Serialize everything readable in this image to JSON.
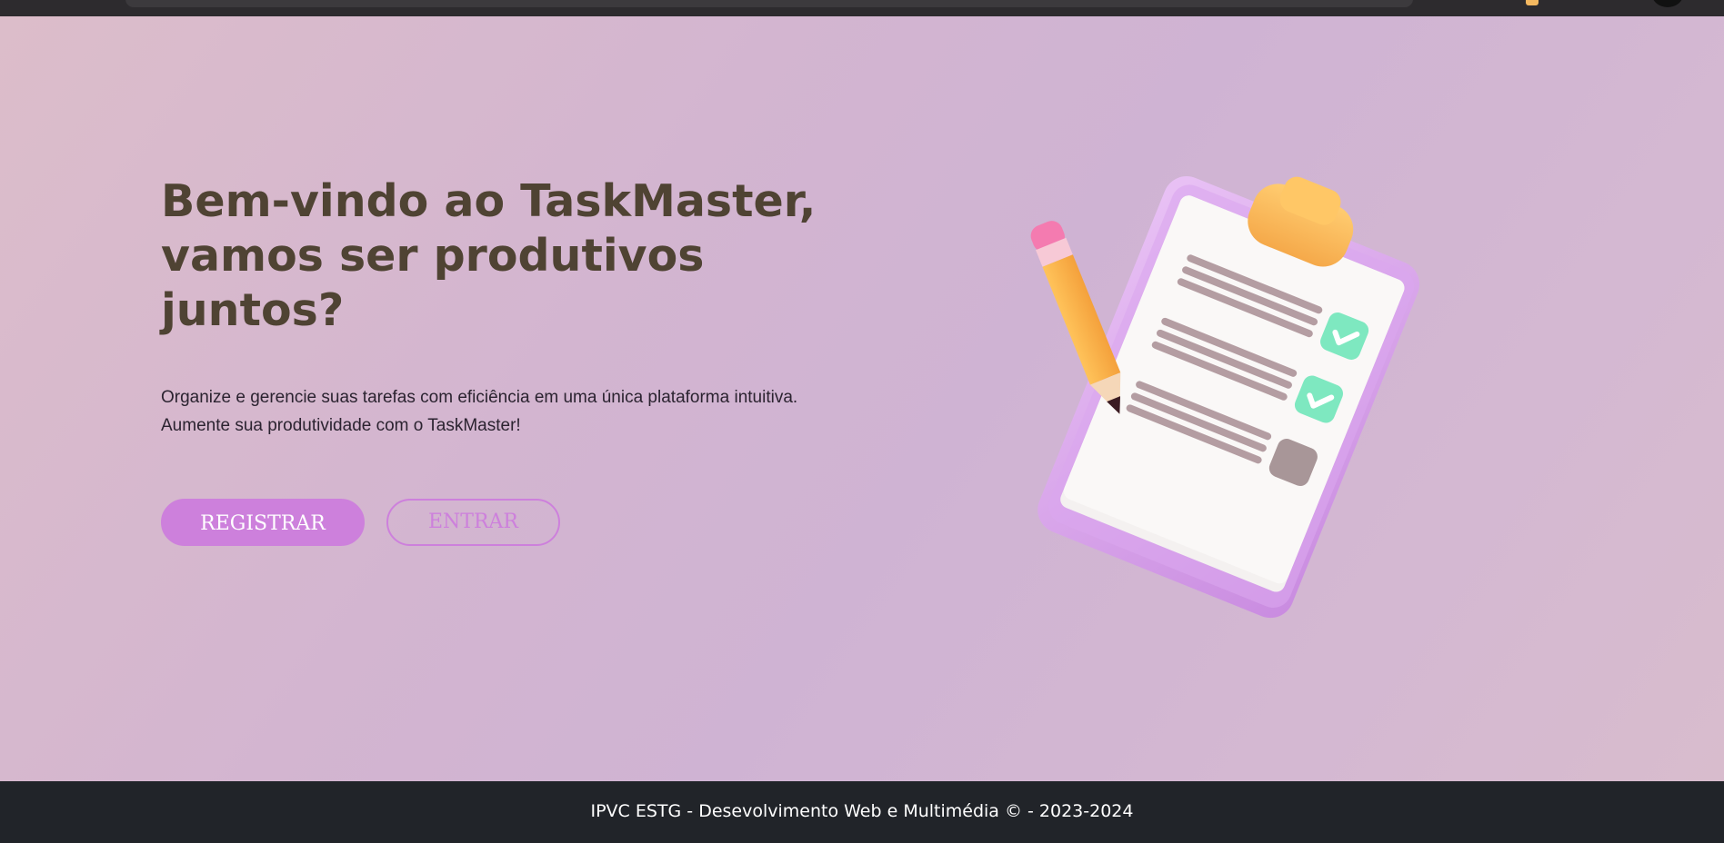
{
  "hero": {
    "title": "Bem-vindo ao TaskMaster, vamos ser produtivos juntos?",
    "description_line1": "Organize e gerencie suas tarefas com eficiência em uma única plataforma intuitiva.",
    "description_line2": "Aumente sua produtividade com o TaskMaster!",
    "register_label": "REGISTRAR",
    "login_label": "ENTRAR"
  },
  "illustration": {
    "icon": "clipboard-checklist-icon",
    "tasks": [
      {
        "checked": true
      },
      {
        "checked": true
      },
      {
        "checked": false
      }
    ]
  },
  "footer": {
    "text": "IPVC ESTG - Desevolvimento Web e Multimédia © - 2023-2024"
  },
  "colors": {
    "accent": "#cd80dc",
    "title": "#4f4333",
    "footer_bg": "#212429",
    "check_green": "#7ee8c0"
  }
}
